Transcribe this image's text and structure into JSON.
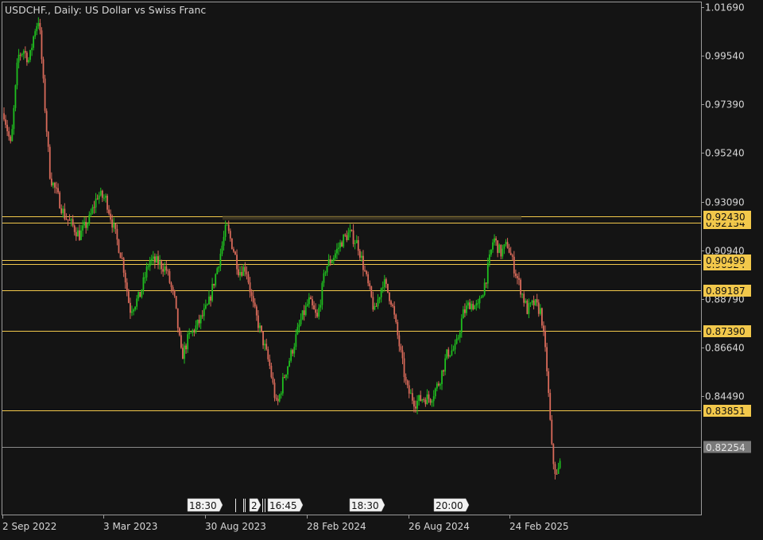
{
  "colors": {
    "background": "#141414",
    "frame": "#9a9a9a",
    "text": "#d6d6d6",
    "up_candle": "#1fbf1f",
    "down_candle": "#d86a5a",
    "level_line": "#f2c84b",
    "level_label_bg": "#f2c84b",
    "current_price_line": "#8a8a8a",
    "current_price_label_bg": "#7a7a7a"
  },
  "chart_data": {
    "type": "candlestick",
    "title": "USDCHF., Daily:  US Dollar vs Swiss Franc",
    "symbol": "USDCHF.",
    "timeframe": "Daily",
    "description": "US Dollar vs Swiss Franc",
    "ylim": [
      0.8045,
      1.0169
    ],
    "y_ticks": [
      "1.01690",
      "0.99540",
      "0.97390",
      "0.95240",
      "0.93090",
      "0.90940",
      "0.88790",
      "0.86640",
      "0.84490",
      "0.82254"
    ],
    "x_ticks": [
      "2 Sep 2022",
      "3 Mar 2023",
      "30 Aug 2023",
      "28 Feb 2024",
      "26 Aug 2024",
      "24 Feb 2025"
    ],
    "horizontal_levels": [
      {
        "value": 0.9243,
        "label": "0.92430"
      },
      {
        "value": 0.92154,
        "label": "0.92154"
      },
      {
        "value": 0.90499,
        "label": "0.90499"
      },
      {
        "value": 0.90324,
        "label": "0.90324"
      },
      {
        "value": 0.89187,
        "label": "0.89187"
      },
      {
        "value": 0.8739,
        "label": "0.87390"
      },
      {
        "value": 0.83851,
        "label": "0.83851"
      }
    ],
    "current_price": {
      "value": 0.82254,
      "label": "0.82254"
    },
    "event_markers": [
      "18:30",
      "2",
      "16:45",
      "18:30",
      "20:00"
    ],
    "price_path": [
      [
        0,
        0.97
      ],
      [
        0.01,
        0.955
      ],
      [
        0.02,
        0.995
      ],
      [
        0.028,
        0.998
      ],
      [
        0.036,
        0.993
      ],
      [
        0.044,
        1.007
      ],
      [
        0.05,
        1.012
      ],
      [
        0.058,
        0.975
      ],
      [
        0.066,
        0.942
      ],
      [
        0.076,
        0.934
      ],
      [
        0.086,
        0.925
      ],
      [
        0.096,
        0.921
      ],
      [
        0.108,
        0.916
      ],
      [
        0.122,
        0.923
      ],
      [
        0.134,
        0.934
      ],
      [
        0.146,
        0.932
      ],
      [
        0.158,
        0.918
      ],
      [
        0.17,
        0.904
      ],
      [
        0.18,
        0.883
      ],
      [
        0.194,
        0.889
      ],
      [
        0.208,
        0.905
      ],
      [
        0.22,
        0.904
      ],
      [
        0.232,
        0.901
      ],
      [
        0.244,
        0.887
      ],
      [
        0.254,
        0.862
      ],
      [
        0.264,
        0.871
      ],
      [
        0.278,
        0.877
      ],
      [
        0.292,
        0.885
      ],
      [
        0.306,
        0.903
      ],
      [
        0.318,
        0.92
      ],
      [
        0.328,
        0.91
      ],
      [
        0.336,
        0.9
      ],
      [
        0.346,
        0.902
      ],
      [
        0.356,
        0.885
      ],
      [
        0.368,
        0.872
      ],
      [
        0.38,
        0.858
      ],
      [
        0.39,
        0.84
      ],
      [
        0.4,
        0.853
      ],
      [
        0.412,
        0.865
      ],
      [
        0.424,
        0.878
      ],
      [
        0.436,
        0.887
      ],
      [
        0.448,
        0.879
      ],
      [
        0.46,
        0.902
      ],
      [
        0.472,
        0.907
      ],
      [
        0.484,
        0.914
      ],
      [
        0.494,
        0.917
      ],
      [
        0.506,
        0.912
      ],
      [
        0.518,
        0.897
      ],
      [
        0.53,
        0.882
      ],
      [
        0.542,
        0.896
      ],
      [
        0.554,
        0.887
      ],
      [
        0.566,
        0.866
      ],
      [
        0.576,
        0.848
      ],
      [
        0.588,
        0.842
      ],
      [
        0.598,
        0.844
      ],
      [
        0.61,
        0.844
      ],
      [
        0.622,
        0.851
      ],
      [
        0.634,
        0.864
      ],
      [
        0.646,
        0.866
      ],
      [
        0.656,
        0.881
      ],
      [
        0.666,
        0.886
      ],
      [
        0.678,
        0.884
      ],
      [
        0.69,
        0.898
      ],
      [
        0.7,
        0.915
      ],
      [
        0.71,
        0.908
      ],
      [
        0.72,
        0.912
      ],
      [
        0.73,
        0.901
      ],
      [
        0.74,
        0.891
      ],
      [
        0.748,
        0.883
      ],
      [
        0.758,
        0.886
      ],
      [
        0.768,
        0.882
      ],
      [
        0.776,
        0.858
      ],
      [
        0.784,
        0.818
      ],
      [
        0.79,
        0.809
      ],
      [
        0.795,
        0.815
      ]
    ]
  }
}
